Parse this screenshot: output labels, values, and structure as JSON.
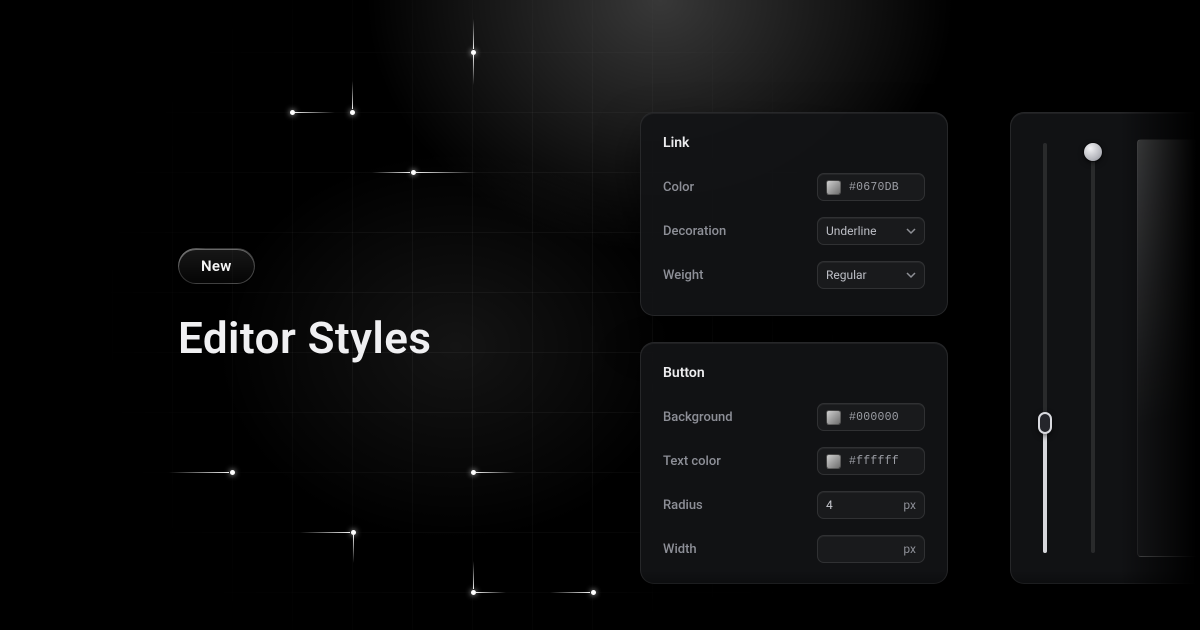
{
  "hero": {
    "badge": "New",
    "title": "Editor Styles"
  },
  "panel_link": {
    "title": "Link",
    "rows": {
      "color": {
        "label": "Color",
        "value": "#0670DB"
      },
      "deco": {
        "label": "Decoration",
        "value": "Underline"
      },
      "weight": {
        "label": "Weight",
        "value": "Regular"
      }
    }
  },
  "panel_button": {
    "title": "Button",
    "rows": {
      "bg": {
        "label": "Background",
        "value": "#000000"
      },
      "text": {
        "label": "Text color",
        "value": "#ffffff"
      },
      "radius": {
        "label": "Radius",
        "value": "4",
        "unit": "px"
      },
      "width": {
        "label": "Width",
        "value": "",
        "unit": "px"
      }
    }
  },
  "sliders": {
    "left": {
      "percent": 68
    },
    "right": {
      "percent": 3
    }
  }
}
